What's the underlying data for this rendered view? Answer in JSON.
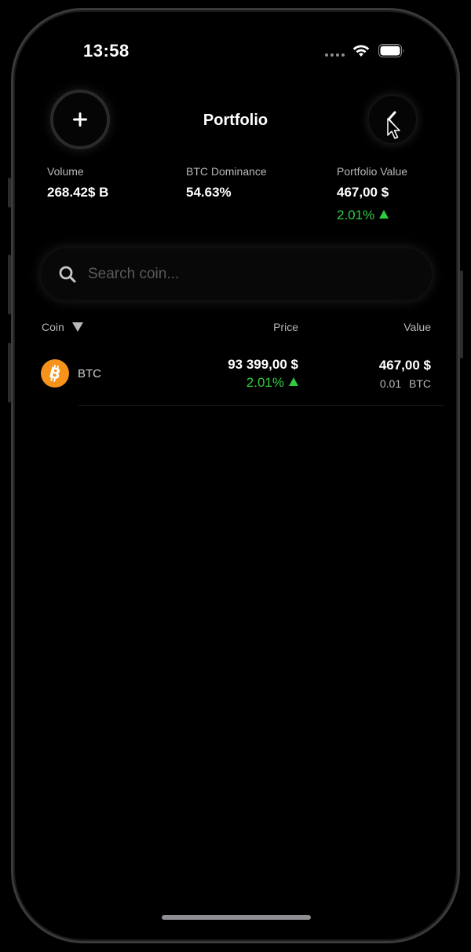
{
  "status_bar": {
    "time": "13:58"
  },
  "header": {
    "title": "Portfolio",
    "add_icon": "plus-icon",
    "back_icon": "chevron-left-icon"
  },
  "stats": [
    {
      "label": "Volume",
      "value": "268.42$ B"
    },
    {
      "label": "BTC Dominance",
      "value": "54.63%"
    },
    {
      "label": "Portfolio Value",
      "value": "467,00 $",
      "change": "2.01%"
    }
  ],
  "search": {
    "placeholder": "Search coin..."
  },
  "columns": {
    "coin": "Coin",
    "price": "Price",
    "value": "Value"
  },
  "coins": [
    {
      "symbol": "BTC",
      "price": "93 399,00 $",
      "change": "2.01%",
      "value": "467,00 $",
      "holdings": "0.01 BTC"
    }
  ],
  "colors": {
    "background": "#000000",
    "positive": "#2ECC40",
    "btc": "#F7931A"
  }
}
